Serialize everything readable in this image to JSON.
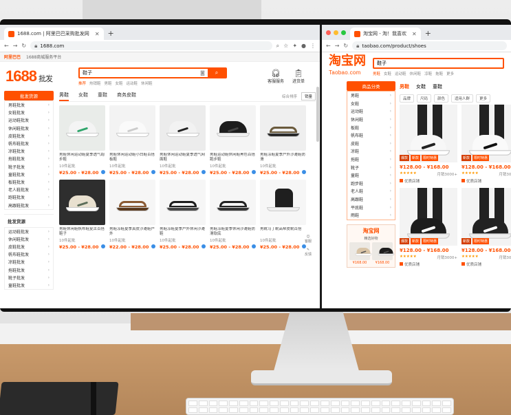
{
  "left_browser": {
    "tab_title": "1688.com | 阿里巴巴采购批发网",
    "url": "1688.com",
    "topstrip": {
      "brand": "阿里巴巴",
      "platform": "1688商城服务平台",
      "links": [
        "我的采购车",
        "我的订单",
        "阿里巴巴客服",
        "已卖出货",
        "立即开店"
      ]
    },
    "logo": "1688",
    "logo_sub": "批发",
    "search": {
      "value": "鞋子",
      "button": "搜索",
      "hot_label": "推荐",
      "hot": [
        "热销鞋",
        "男鞋",
        "女鞋",
        "运动鞋",
        "休闲鞋"
      ]
    },
    "header_icons": [
      {
        "icon": "headset-icon",
        "label": "客服服务"
      },
      {
        "icon": "clipboard-icon",
        "label": "进货单"
      }
    ],
    "categories_title": "批发货源",
    "categories": [
      "男鞋批发",
      "女鞋批发",
      "运动鞋批发",
      "休闲鞋批发",
      "皮鞋批发",
      "帆布鞋批发",
      "凉鞋批发",
      "拖鞋批发",
      "靴子批发",
      "童鞋批发",
      "板鞋批发",
      "老人鞋批发",
      "跑鞋批发",
      "高跟鞋批发"
    ],
    "sub_title": "批发货源",
    "sub_categories": [
      "运动鞋批发",
      "休闲鞋批发",
      "皮鞋批发",
      "帆布鞋批发",
      "凉鞋批发",
      "拖鞋批发",
      "靴子批发",
      "童鞋批发"
    ],
    "tabs": [
      "男鞋",
      "女鞋",
      "童鞋",
      "商务皮鞋"
    ],
    "sort_label": "综合排序",
    "sort_value": "销量",
    "products": [
      {
        "title": "男鞋休闲运动鞋夏季透气跑步鞋",
        "sold": "10件起批",
        "price": "¥25.00 - ¥28.00",
        "kind": "sneaker",
        "color": "#f4f4f4",
        "accent": "#2fa56b",
        "bg": "#e9ece9"
      },
      {
        "title": "男鞋休闲运动鞋小白鞋百搭板鞋",
        "sold": "10件起批",
        "price": "¥25.00 - ¥28.00",
        "kind": "sneaker",
        "color": "#fafafa",
        "accent": "#cccccc",
        "bg": "#f3f3f3"
      },
      {
        "title": "男鞋休闲运动鞋夏季透气网面鞋",
        "sold": "10件起批",
        "price": "¥25.00 - ¥28.00",
        "kind": "sneaker",
        "color": "#f2f2f2",
        "accent": "#222222",
        "bg": "#ececec"
      },
      {
        "title": "男鞋运动鞋休闲鞋黑色百搭跑步鞋",
        "sold": "10件起批",
        "price": "¥25.00 - ¥28.00",
        "kind": "sneaker",
        "color": "#1d1d1d",
        "accent": "#444444",
        "bg": "#f4f4f4"
      },
      {
        "title": "男鞋凉鞋夏季户外沙滩鞋防滑",
        "sold": "10件起批",
        "price": "¥25.00 - ¥28.00",
        "kind": "sandal",
        "color": "#6a5a3c",
        "accent": "#2a2a2a",
        "bg": "#efefef"
      },
      {
        "title": "男鞋休闲鞋帆布鞋复古百搭鞋子",
        "sold": "10件起批",
        "price": "¥25.00 - ¥28.00",
        "kind": "sneaker",
        "color": "#e8e0cf",
        "accent": "#5c6e5a",
        "bg": "#2e2e2e"
      },
      {
        "title": "男鞋凉鞋夏季真皮沙滩鞋户外",
        "sold": "10件起批",
        "price": "¥22.00 - ¥28.00",
        "kind": "sandal",
        "color": "#8a5a33",
        "accent": "#5a3a1f",
        "bg": "#f6f6f6"
      },
      {
        "title": "男鞋凉鞋夏季户外休闲沙滩鞋",
        "sold": "10件起批",
        "price": "¥25.00 - ¥28.00",
        "kind": "sandal",
        "color": "#1d1d1d",
        "accent": "#444444",
        "bg": "#f6f6f6"
      },
      {
        "title": "男鞋凉鞋夏季休闲沙滩鞋防滑软底",
        "sold": "10件起批",
        "price": "¥25.00 - ¥28.00",
        "kind": "sandal",
        "color": "#222222",
        "accent": "#333333",
        "bg": "#f6f6f6"
      },
      {
        "title": "男靴马丁靴高帮皮靴百搭",
        "sold": "10件起批",
        "price": "¥25.00 - ¥28.00",
        "kind": "boot",
        "color": "#1f1f1f",
        "accent": "#333333",
        "bg": "#f6f6f6"
      }
    ],
    "side_float": [
      "客服",
      "反馈"
    ]
  },
  "right_browser": {
    "tab_title": "淘宝网 - 淘！我喜欢",
    "url": "taobao.com/product/shoes",
    "logo": "淘宝网",
    "logo_en": "Taobao.com",
    "search": {
      "value": "鞋子",
      "hot": [
        "男鞋",
        "女鞋",
        "运动鞋",
        "休闲鞋",
        "凉鞋",
        "拖鞋",
        "更多"
      ]
    },
    "categories_title": "商品分类",
    "categories": [
      "男鞋",
      "女鞋",
      "运动鞋",
      "休闲鞋",
      "板鞋",
      "帆布鞋",
      "皮鞋",
      "凉鞋",
      "拖鞋",
      "靴子",
      "童鞋",
      "跑步鞋",
      "老人鞋",
      "高跟鞋",
      "平底鞋",
      "雨鞋"
    ],
    "promo": {
      "logo": "淘宝网",
      "text": "精选好物",
      "items": [
        {
          "price": "¥168.00"
        },
        {
          "price": "¥168.00"
        }
      ]
    },
    "tabs": [
      "男鞋",
      "女鞋",
      "童鞋"
    ],
    "filters": [
      "品牌",
      "尺码",
      "颜色",
      "适用人群",
      "更多"
    ],
    "products": [
      {
        "price": "¥128.00 - ¥168.00",
        "sold": "月销3000+",
        "shop": "优质店铺",
        "tags": [
          "爆款",
          "新款",
          "限时特惠"
        ],
        "color": "#f7f7f7",
        "accent": "#222222"
      },
      {
        "price": "¥128.00 - ¥168.00",
        "sold": "月销3000+",
        "shop": "优质店铺",
        "tags": [
          "新款",
          "限时特惠"
        ],
        "color": "#fafafa",
        "accent": "#111111"
      },
      {
        "price": "¥128.00 - ¥168.00",
        "sold": "月销3000+",
        "shop": "优质店铺",
        "tags": [
          "爆款",
          "新款",
          "限时特惠"
        ],
        "color": "#1d1d1d",
        "accent": "#ffffff"
      },
      {
        "price": "¥128.00 - ¥168.00",
        "sold": "月销3000+",
        "shop": "优质店铺",
        "tags": [
          "新款",
          "限时特惠"
        ],
        "color": "#222222",
        "accent": "#ffffff"
      }
    ]
  },
  "colors": {
    "alibaba_orange": "#ff5000",
    "taobao_orange": "#ff5000"
  }
}
